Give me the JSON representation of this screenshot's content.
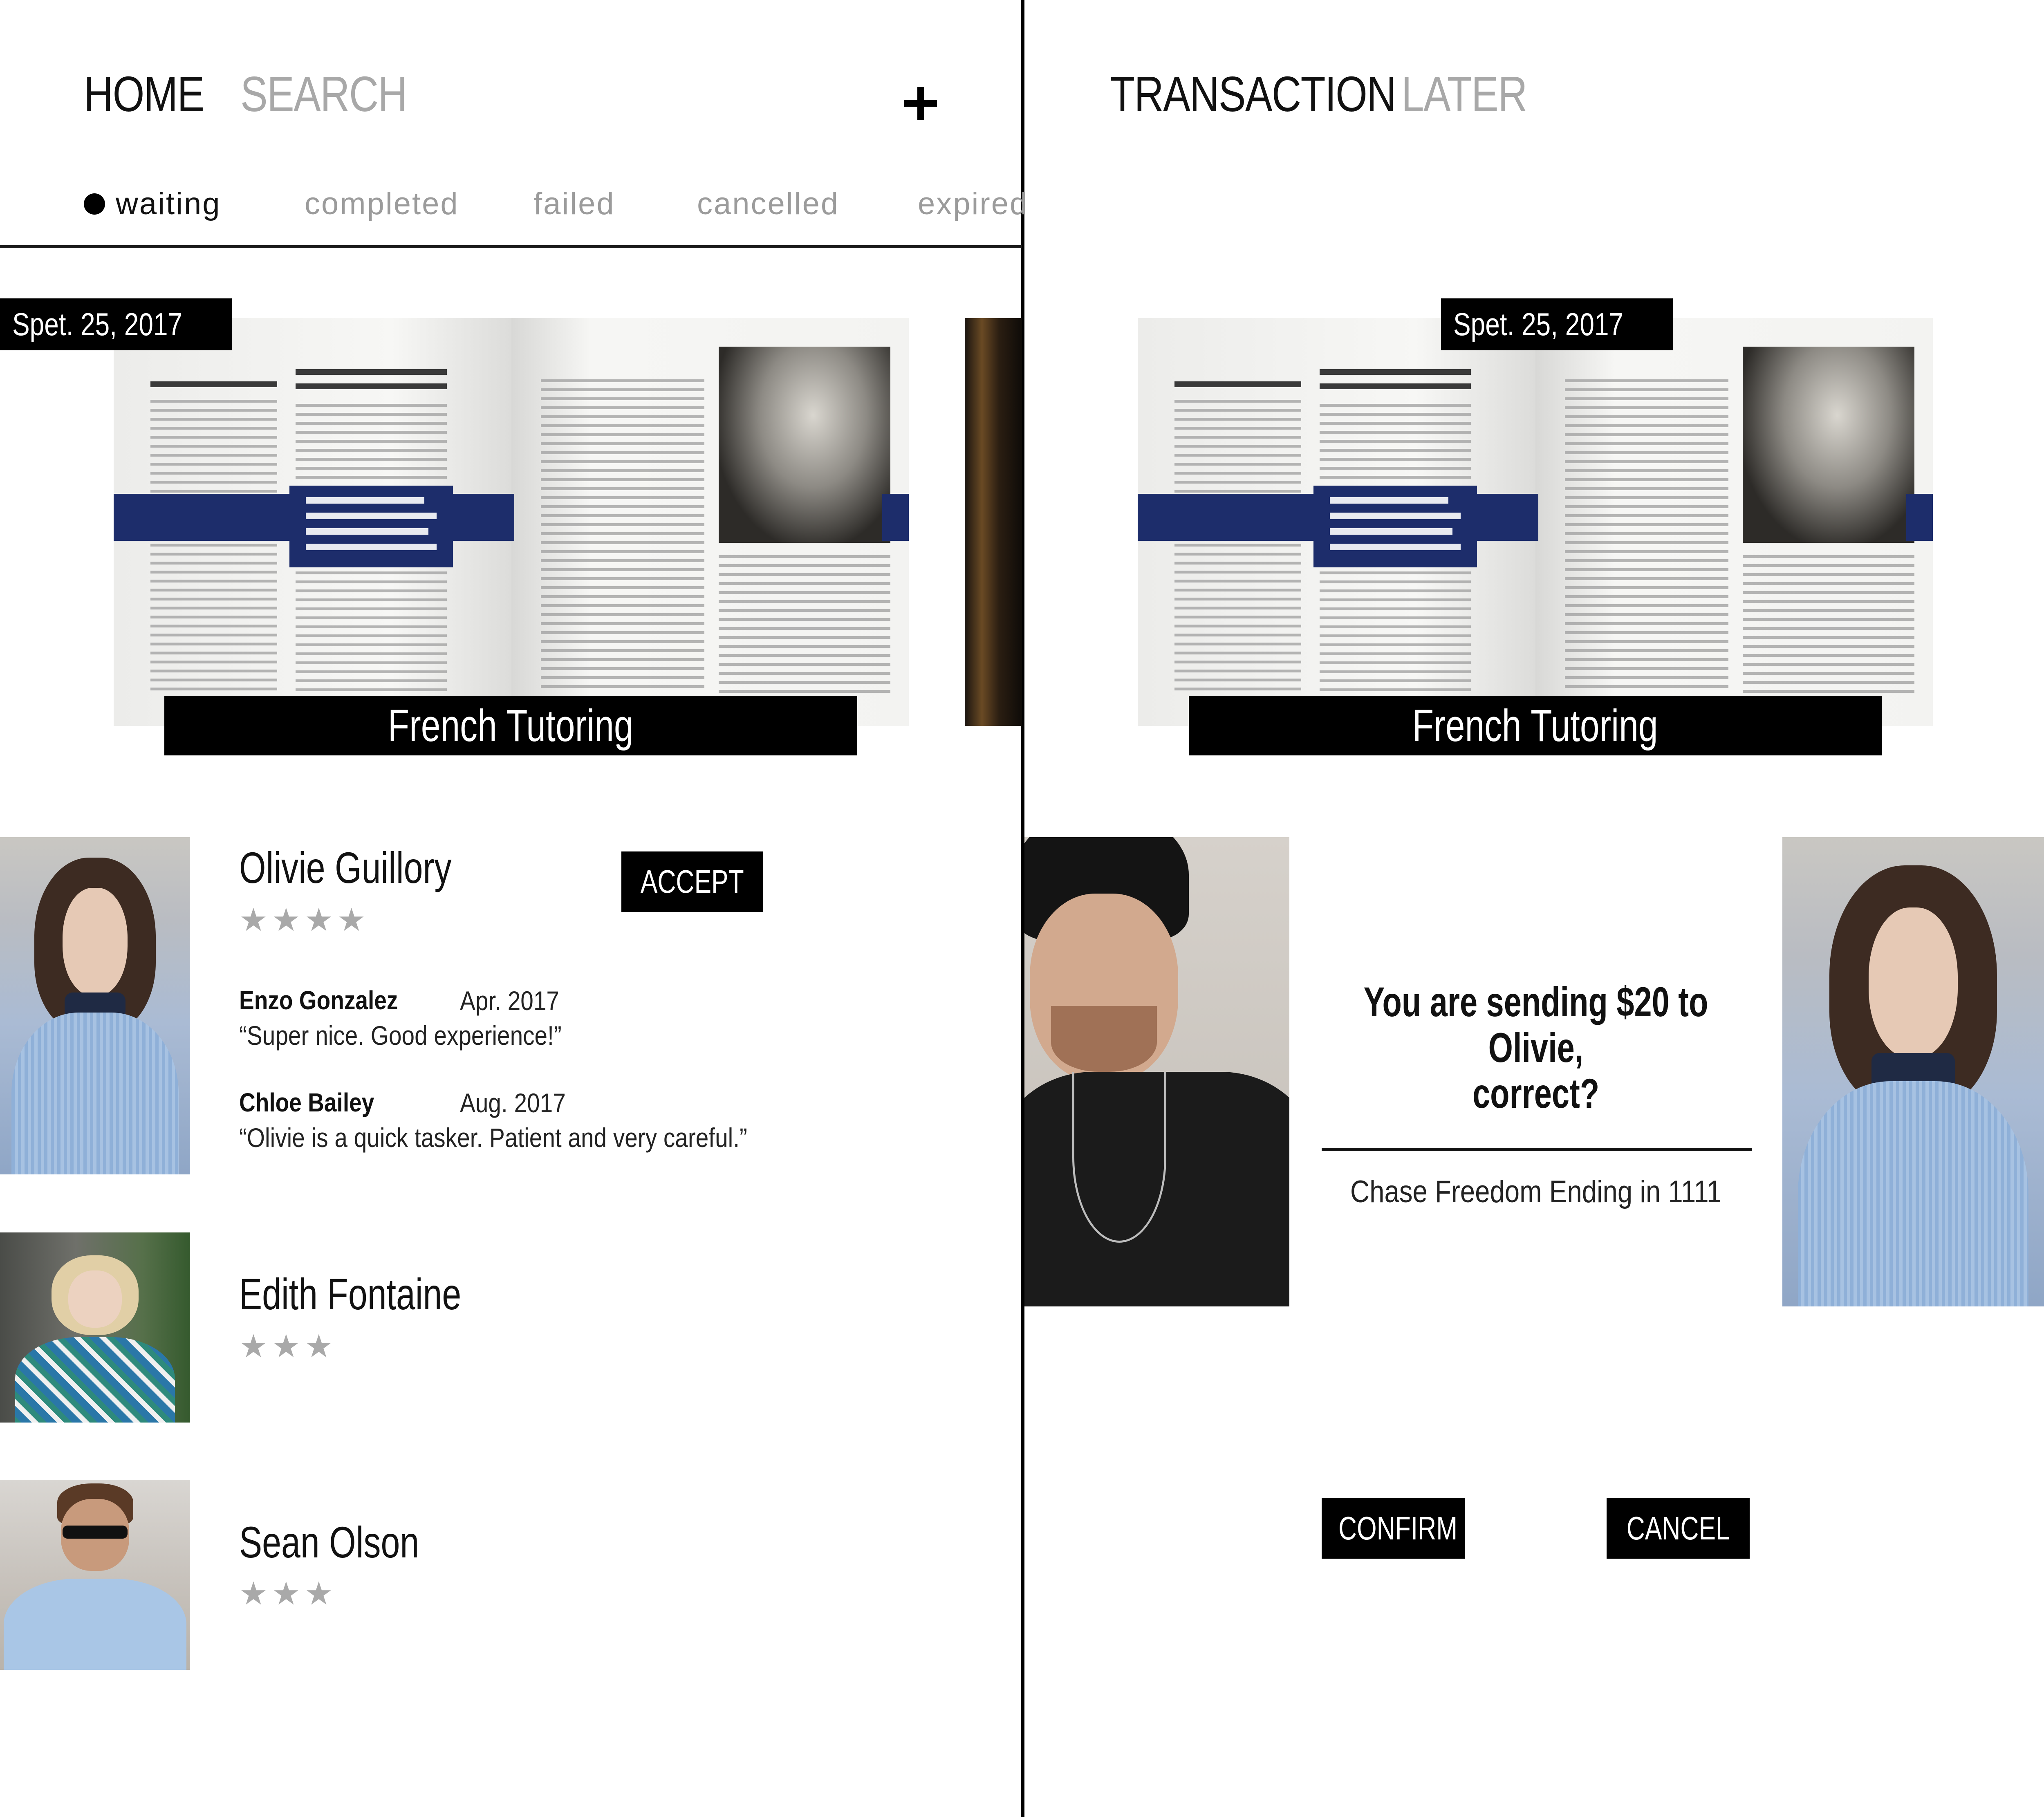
{
  "left_panel": {
    "nav": {
      "home": "HOME",
      "search": "SEARCH",
      "add_icon": "plus-icon"
    },
    "filters": [
      {
        "label": "waiting",
        "active": true
      },
      {
        "label": "completed",
        "active": false
      },
      {
        "label": "failed",
        "active": false
      },
      {
        "label": "cancelled",
        "active": false
      },
      {
        "label": "expired",
        "active": false
      }
    ],
    "job": {
      "date": "Spet. 25, 2017",
      "title": "French Tutoring"
    },
    "taskers": [
      {
        "name": "Olivie Guillory",
        "stars": "★★★★",
        "rating": 4,
        "action": "ACCEPT",
        "reviews": [
          {
            "author": "Enzo Gonzalez",
            "date": "Apr. 2017",
            "text": "“Super nice. Good experience!”"
          },
          {
            "author": "Chloe Bailey",
            "date": "Aug. 2017",
            "text": "“Olivie is a quick tasker. Patient and very careful.”"
          }
        ]
      },
      {
        "name": "Edith Fontaine",
        "stars": "★★★",
        "rating": 3
      },
      {
        "name": "Sean Olson",
        "stars": "★★★",
        "rating": 3
      }
    ]
  },
  "right_panel": {
    "nav": {
      "transaction": "TRANSACTION",
      "later": "LATER"
    },
    "job": {
      "date": "Spet. 25, 2017",
      "title": "French Tutoring"
    },
    "confirm": {
      "line1": "You are sending $20 to Olivie,",
      "line2": "correct?",
      "card": "Chase Freedom Ending in 1111"
    },
    "buttons": {
      "confirm": "CONFIRM",
      "cancel": "CANCEL"
    }
  },
  "colors": {
    "accent_blue": "#1d2d6b",
    "inactive_gray": "#a8a8a8",
    "black": "#000000"
  }
}
